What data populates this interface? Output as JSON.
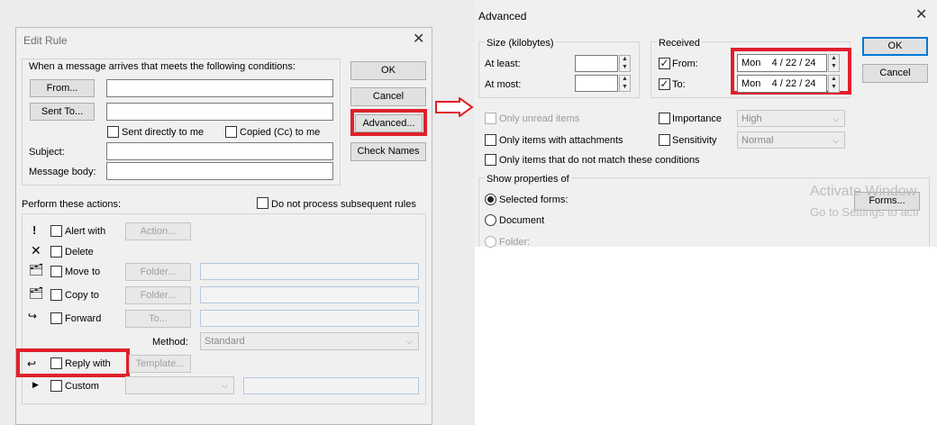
{
  "edit_rule": {
    "title": "Edit Rule",
    "conditions_header": "When a message arrives that meets the following conditions:",
    "from_button": "From...",
    "sent_to_button": "Sent To...",
    "sent_directly": "Sent directly to me",
    "copied_to": "Copied (Cc) to me",
    "subject_label": "Subject:",
    "body_label": "Message body:",
    "ok": "OK",
    "cancel": "Cancel",
    "advanced": "Advanced...",
    "check_names": "Check Names",
    "actions_header": "Perform these actions:",
    "do_not_process": "Do not process subsequent rules",
    "actions": [
      {
        "label": "Alert with",
        "button": "Action..."
      },
      {
        "label": "Delete"
      },
      {
        "label": "Move to",
        "button": "Folder..."
      },
      {
        "label": "Copy to",
        "button": "Folder..."
      },
      {
        "label": "Forward",
        "button": "To..."
      },
      {
        "label": "Reply with",
        "button": "Template..."
      },
      {
        "label": "Custom"
      }
    ],
    "method_label": "Method:",
    "method_value": "Standard"
  },
  "advanced": {
    "title": "Advanced",
    "size_header": "Size (kilobytes)",
    "at_least": "At least:",
    "at_most": "At most:",
    "received_header": "Received",
    "from_label": "From:",
    "to_label": "To:",
    "from_date": "Mon    4 / 22 / 24",
    "to_date": "Mon    4 / 22 / 24",
    "ok": "OK",
    "cancel": "Cancel",
    "only_unread": "Only unread items",
    "only_attachments": "Only items with attachments",
    "not_match": "Only items that do not match these conditions",
    "importance_label": "Importance",
    "importance_value": "High",
    "sensitivity_label": "Sensitivity",
    "sensitivity_value": "Normal",
    "show_props_header": "Show properties of",
    "selected_forms": "Selected forms:",
    "document": "Document",
    "folder": "Folder:",
    "forms_button": "Forms...",
    "watermark_line1": "Activate Window",
    "watermark_line2": "Go to Settings to acti"
  },
  "colors": {
    "highlight": "#e0202a",
    "accent": "#0078d7"
  }
}
